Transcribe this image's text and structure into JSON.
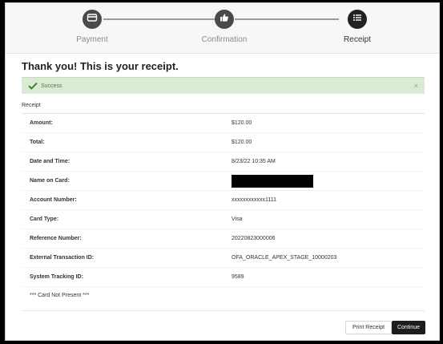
{
  "wizard": {
    "steps": [
      {
        "label": "Payment",
        "icon": "credit-card-icon",
        "active": false
      },
      {
        "label": "Confirmation",
        "icon": "thumbs-up-icon",
        "active": false
      },
      {
        "label": "Receipt",
        "icon": "list-icon",
        "active": true
      }
    ]
  },
  "receipt": {
    "title": "Thank you! This is your receipt.",
    "alert": {
      "text": "Success",
      "close": "×",
      "color": "#dbead4"
    },
    "section_label": "Receipt",
    "rows": [
      {
        "label": "Amount:",
        "value": "$120.00"
      },
      {
        "label": "Total:",
        "value": "$120.00"
      },
      {
        "label": "Date and Time:",
        "value": "8/23/22 10:35 AM"
      },
      {
        "label": "Name on Card:",
        "value": ""
      },
      {
        "label": "Account Number:",
        "value": "xxxxxxxxxxxx1111"
      },
      {
        "label": "Card Type:",
        "value": "Visa"
      },
      {
        "label": "Reference Number:",
        "value": "20220823000006"
      },
      {
        "label": "External Transaction ID:",
        "value": "OFA_ORACLE_APEX_STAGE_10000203"
      },
      {
        "label": "System Tracking ID:",
        "value": "9589"
      }
    ],
    "footer_note": "*** Card Not Present ***"
  },
  "actions": {
    "print_label": "Print Receipt",
    "continue_label": "Continue"
  }
}
